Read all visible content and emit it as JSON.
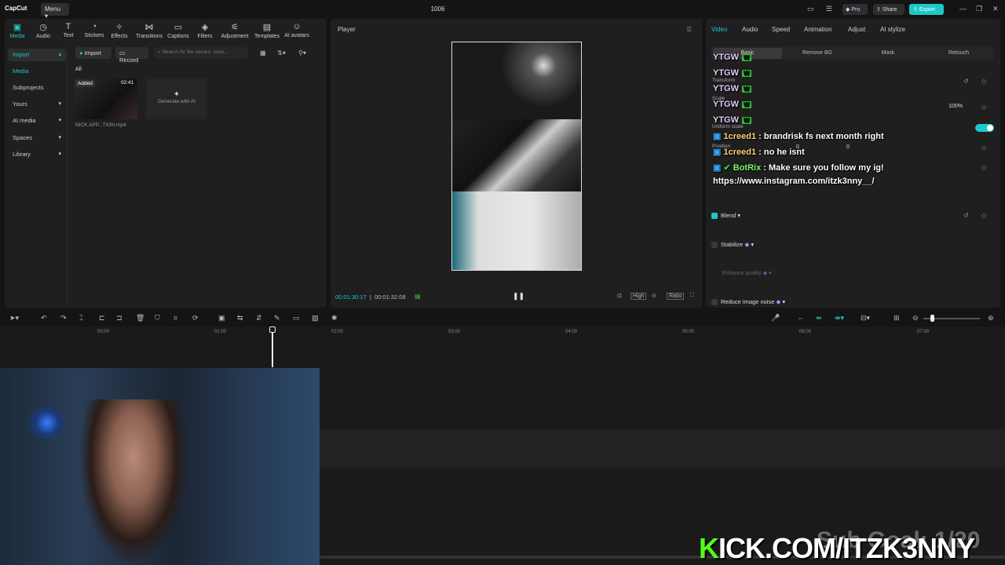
{
  "app": {
    "logo": "CapCut",
    "menu_label": "Menu",
    "project_title": "1006"
  },
  "header": {
    "pro": "Pro",
    "share": "Share",
    "export": "Export"
  },
  "toolbar": [
    {
      "label": "Media",
      "icon": "media-icon"
    },
    {
      "label": "Audio",
      "icon": "audio-icon"
    },
    {
      "label": "Text",
      "icon": "text-icon"
    },
    {
      "label": "Stickers",
      "icon": "stickers-icon"
    },
    {
      "label": "Effects",
      "icon": "effects-icon"
    },
    {
      "label": "Transitions",
      "icon": "transitions-icon"
    },
    {
      "label": "Captions",
      "icon": "captions-icon"
    },
    {
      "label": "Filters",
      "icon": "filters-icon"
    },
    {
      "label": "Adjustment",
      "icon": "adjustment-icon"
    },
    {
      "label": "Templates",
      "icon": "templates-icon"
    },
    {
      "label": "AI avatars",
      "icon": "ai-avatars-icon"
    }
  ],
  "sidebar": {
    "items": [
      "Import",
      "Media",
      "Subprojects",
      "Yours",
      "AI media",
      "Spaces",
      "Library"
    ]
  },
  "media": {
    "import_label": "Import",
    "record_label": "Record",
    "search_placeholder": "Search for file names, scen...",
    "all_label": "All",
    "added_badge": "Added",
    "duration": "02:41",
    "file_name": "NICK APP...TION.mp4",
    "generate_label": "Generate with AI"
  },
  "player": {
    "title": "Player",
    "current_time": "00:01:30:17",
    "total_time": "00:01:32:08",
    "quality": "High",
    "ratio": "Ratio"
  },
  "inspector": {
    "tabs": [
      "Video",
      "Audio",
      "Speed",
      "Animation",
      "Adjust",
      "AI stylize"
    ],
    "subtabs": [
      "Basic",
      "Remove BG",
      "Mask",
      "Retouch"
    ],
    "transform_label": "Transform",
    "scale_label": "Scale",
    "scale_value": "100%",
    "uniform_scale_label": "Uniform scale",
    "position_label": "Position",
    "pos_x": "0",
    "pos_y": "0",
    "blend_label": "Blend",
    "stabilize_label": "Stabilize",
    "enhance_label": "Enhance quality",
    "reduce_noise_label": "Reduce image noise"
  },
  "timeline": {
    "ticks": [
      "00:00",
      "01:00",
      "02:00",
      "03:00",
      "04:00",
      "05:00",
      "06:00",
      "07:00"
    ]
  },
  "chat": [
    {
      "user": "YTGW",
      "msg": "W"
    },
    {
      "user": "YTGW",
      "msg": "W"
    },
    {
      "user": "YTGW",
      "msg": "W"
    },
    {
      "user": "YTGW",
      "msg": "W"
    },
    {
      "user": "YTGW",
      "msg": "W"
    },
    {
      "user": "1creed1",
      "msg": ": brandrisk fs next month right"
    },
    {
      "user": "1creed1",
      "msg": ": no he isnt"
    },
    {
      "user": "BotRix",
      "msg": ": Make sure you follow my ig!"
    },
    {
      "user": "",
      "msg": "https://www.instagram.com/itzk3nny__/"
    }
  ],
  "overlay": {
    "kick_k": "K",
    "kick_rest": "ICK.COM/ITZK3NNY",
    "subgoal": "Sub Goal: 1/20"
  }
}
